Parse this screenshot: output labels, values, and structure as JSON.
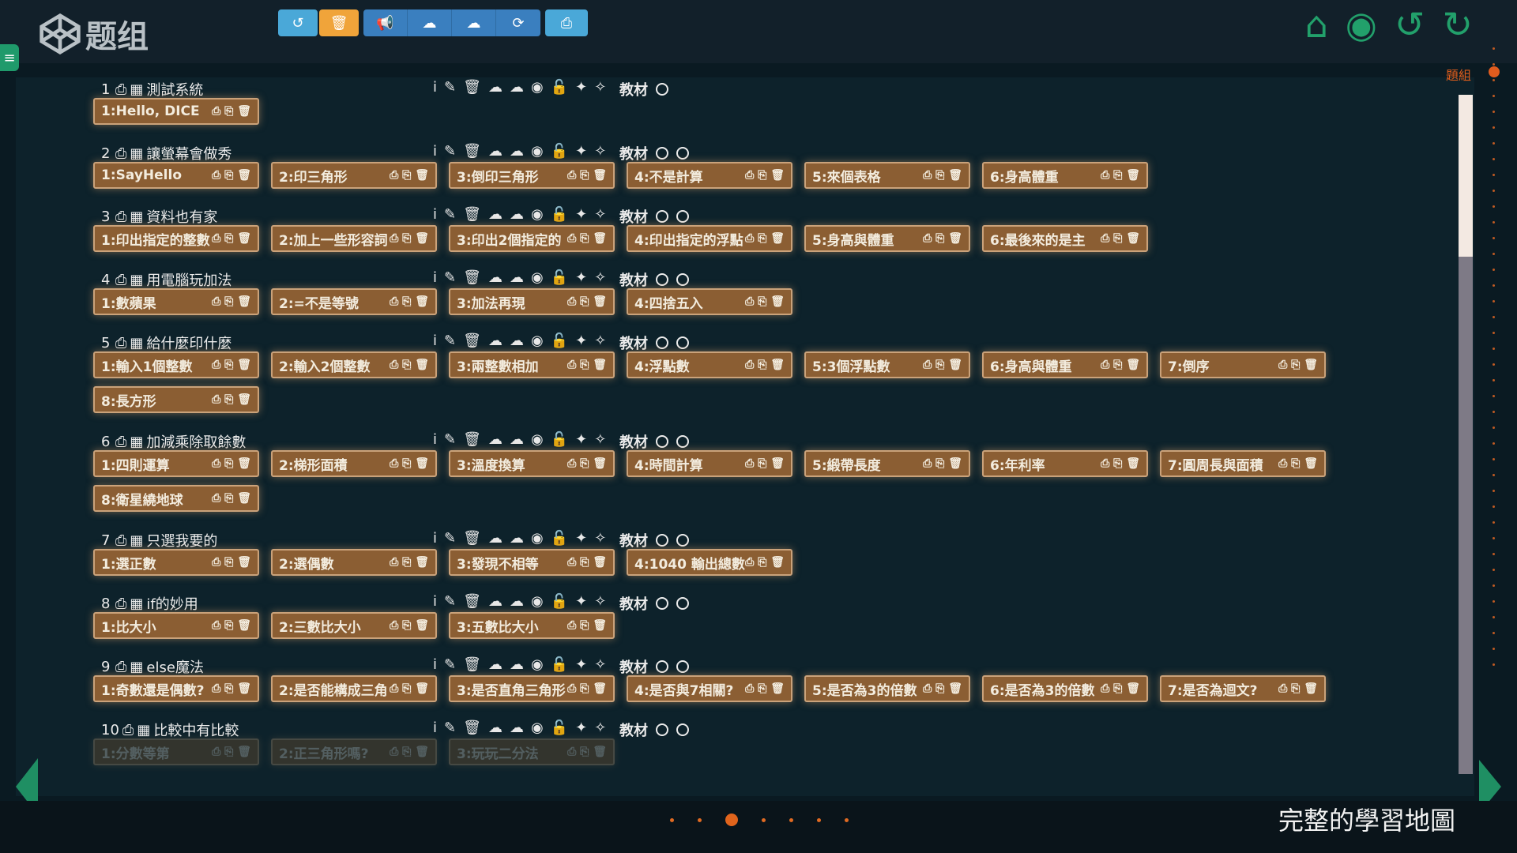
{
  "header": {
    "logo_text": "题组",
    "toolbar_icons": [
      "undo-icon",
      "trash-icon",
      "bullhorn-icon",
      "cloud-download-icon",
      "cloud-upload-icon",
      "refresh-icon",
      "print-icon"
    ],
    "right_icons": [
      "home-icon",
      "eye-icon",
      "undo-icon",
      "redo-icon"
    ],
    "group_label": "題組"
  },
  "lessons": [
    {
      "index": "1",
      "title": "測試系統",
      "has_ban": false,
      "problems": [
        "1:Hello, DICE"
      ]
    },
    {
      "index": "2",
      "title": "讓螢幕會做秀",
      "has_ban": true,
      "problems": [
        "1:SayHello",
        "2:印三角形",
        "3:倒印三角形",
        "4:不是計算",
        "5:來個表格",
        "6:身高體重"
      ]
    },
    {
      "index": "3",
      "title": "資料也有家",
      "has_ban": true,
      "problems": [
        "1:印出指定的整數",
        "2:加上一些形容詞",
        "3:印出2個指定的",
        "4:印出指定的浮點",
        "5:身高與體重",
        "6:最後來的是主"
      ]
    },
    {
      "index": "4",
      "title": "用電腦玩加法",
      "has_ban": true,
      "problems": [
        "1:數蘋果",
        "2:=不是等號",
        "3:加法再現",
        "4:四捨五入"
      ]
    },
    {
      "index": "5",
      "title": "給什麼印什麼",
      "has_ban": true,
      "problems": [
        "1:輸入1個整數",
        "2:輸入2個整數",
        "3:兩整數相加",
        "4:浮點數",
        "5:3個浮點數",
        "6:身高與體重",
        "7:倒序",
        "8:長方形"
      ]
    },
    {
      "index": "6",
      "title": "加減乘除取餘數",
      "has_ban": true,
      "problems": [
        "1:四則運算",
        "2:梯形面積",
        "3:溫度換算",
        "4:時間計算",
        "5:緞帶長度",
        "6:年利率",
        "7:圓周長與面積",
        "8:衛星繞地球"
      ]
    },
    {
      "index": "7",
      "title": "只選我要的",
      "has_ban": true,
      "problems": [
        "1:選正數",
        "2:選偶數",
        "3:發現不相等",
        "4:1040 輸出總數"
      ]
    },
    {
      "index": "8",
      "title": "if的妙用",
      "has_ban": true,
      "problems": [
        "1:比大小",
        "2:三數比大小",
        "3:五數比大小"
      ]
    },
    {
      "index": "9",
      "title": "else魔法",
      "has_ban": true,
      "problems": [
        "1:奇數還是偶數?",
        "2:是否能構成三角",
        "3:是否直角三角形",
        "4:是否與7相關?",
        "5:是否為3的倍數",
        "6:是否為3的倍數",
        "7:是否為迴文?"
      ]
    },
    {
      "index": "10",
      "title": "比較中有比較",
      "has_ban": true,
      "problems": [
        "1:分數等第",
        "2:正三角形嗎?",
        "3:玩玩二分法"
      ]
    }
  ],
  "labels": {
    "textbook": "教材",
    "info": "i"
  },
  "footer": {
    "title": "完整的學習地圖",
    "page_count": 7,
    "active_page": 3
  },
  "colors": {
    "accent_green": "#22a06b",
    "chip_bg": "#8b5e33",
    "accent_orange": "#e25c1e"
  }
}
